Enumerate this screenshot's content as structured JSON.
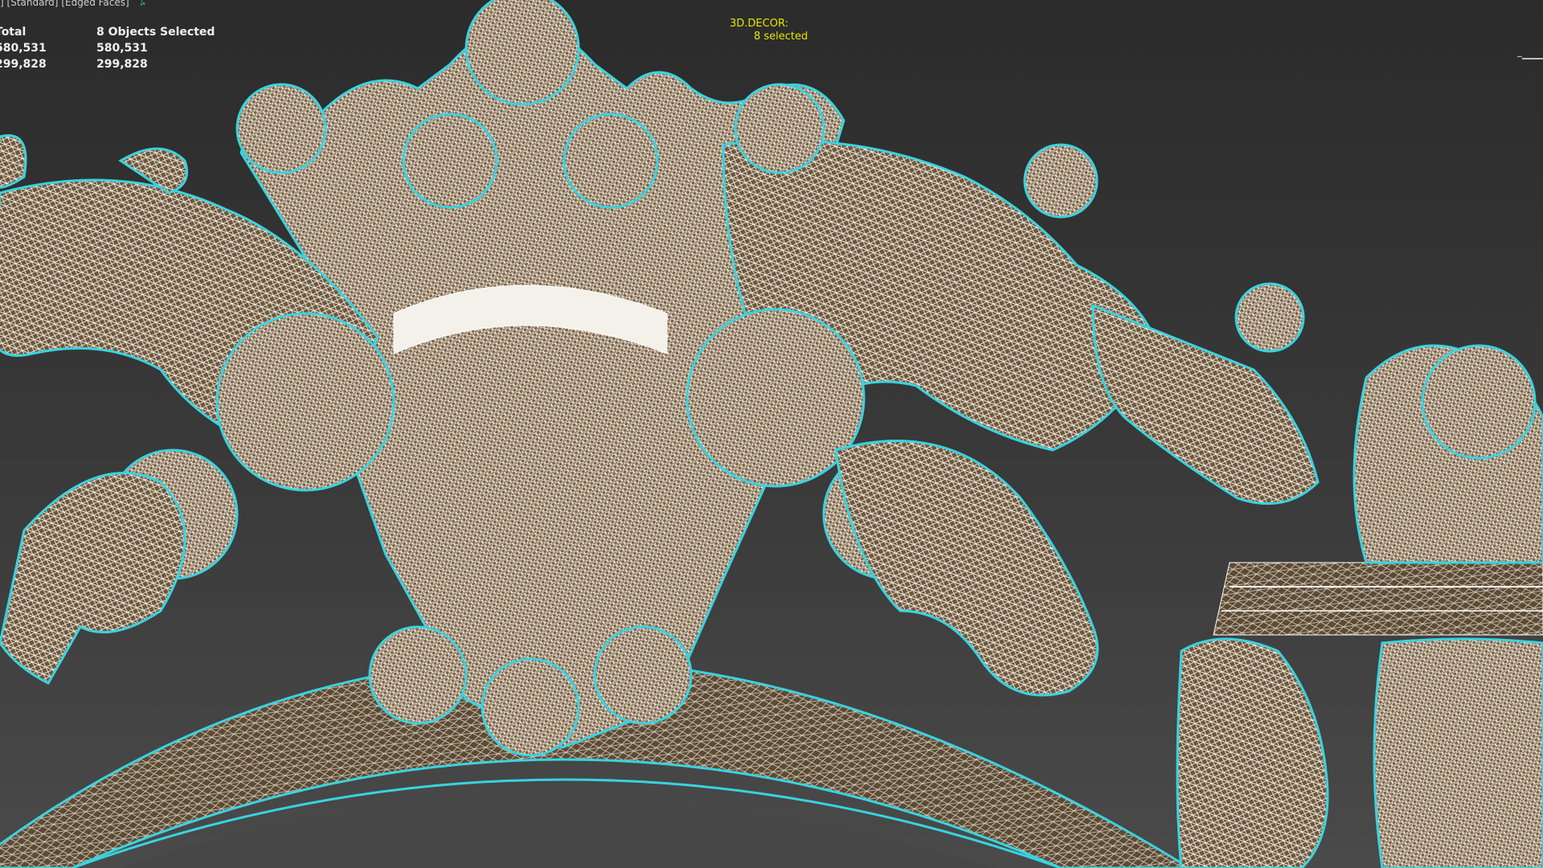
{
  "viewport": {
    "label_parts": [
      "]",
      "[Standard]",
      "[Edged Faces]"
    ],
    "pin_icon": "pin-icon",
    "background_top": "#2b2b2b",
    "background_bottom": "#4a4a4a",
    "wireframe_color": "#ffffff",
    "selection_outline_color": "#39d3e0",
    "surface_color": "#8a6a42"
  },
  "stats": {
    "headers": [
      "Total",
      "8 Objects Selected"
    ],
    "rows": [
      [
        "580,531",
        "580,531"
      ],
      [
        "299,828",
        "299,828"
      ]
    ]
  },
  "scene_info": {
    "name": "3D.DECOR:",
    "selected": "8 selected",
    "color": "#e6e600"
  }
}
